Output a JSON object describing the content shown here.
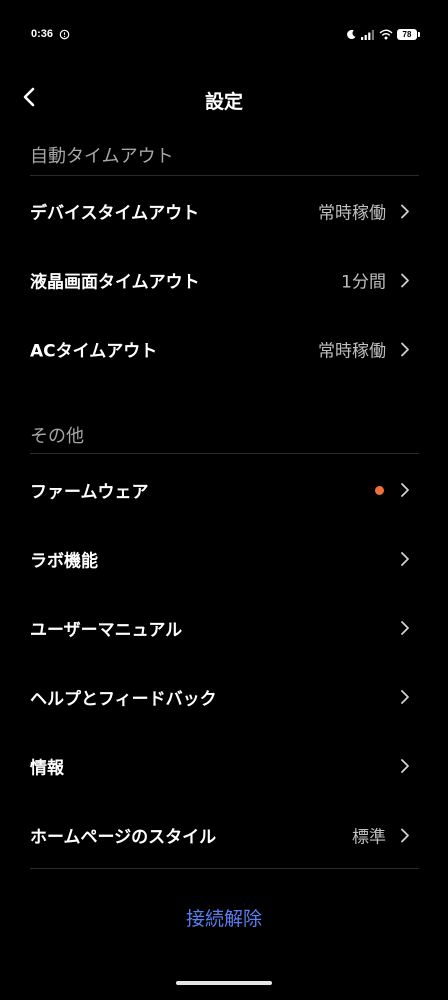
{
  "status_bar": {
    "time": "0:36",
    "battery": "78"
  },
  "header": {
    "title": "設定"
  },
  "sections": [
    {
      "title": "自動タイムアウト",
      "items": [
        {
          "label": "デバイスタイムアウト",
          "value": "常時稼働"
        },
        {
          "label": "液晶画面タイムアウト",
          "value": "1分間"
        },
        {
          "label": "ACタイムアウト",
          "value": "常時稼働"
        }
      ]
    },
    {
      "title": "その他",
      "items": [
        {
          "label": "ファームウェア",
          "value": "",
          "badge_color": "#f0703a"
        },
        {
          "label": "ラボ機能",
          "value": ""
        },
        {
          "label": "ユーザーマニュアル",
          "value": ""
        },
        {
          "label": "ヘルプとフィードバック",
          "value": ""
        },
        {
          "label": "情報",
          "value": ""
        },
        {
          "label": "ホームページのスタイル",
          "value": "標準"
        }
      ]
    }
  ],
  "footer": {
    "disconnect_label": "接続解除"
  },
  "colors": {
    "background": "#000000",
    "section_title": "#a6a6a6",
    "value_text": "#bfbfbf",
    "accent_link": "#5b7ef0",
    "update_dot": "#f0703a"
  }
}
